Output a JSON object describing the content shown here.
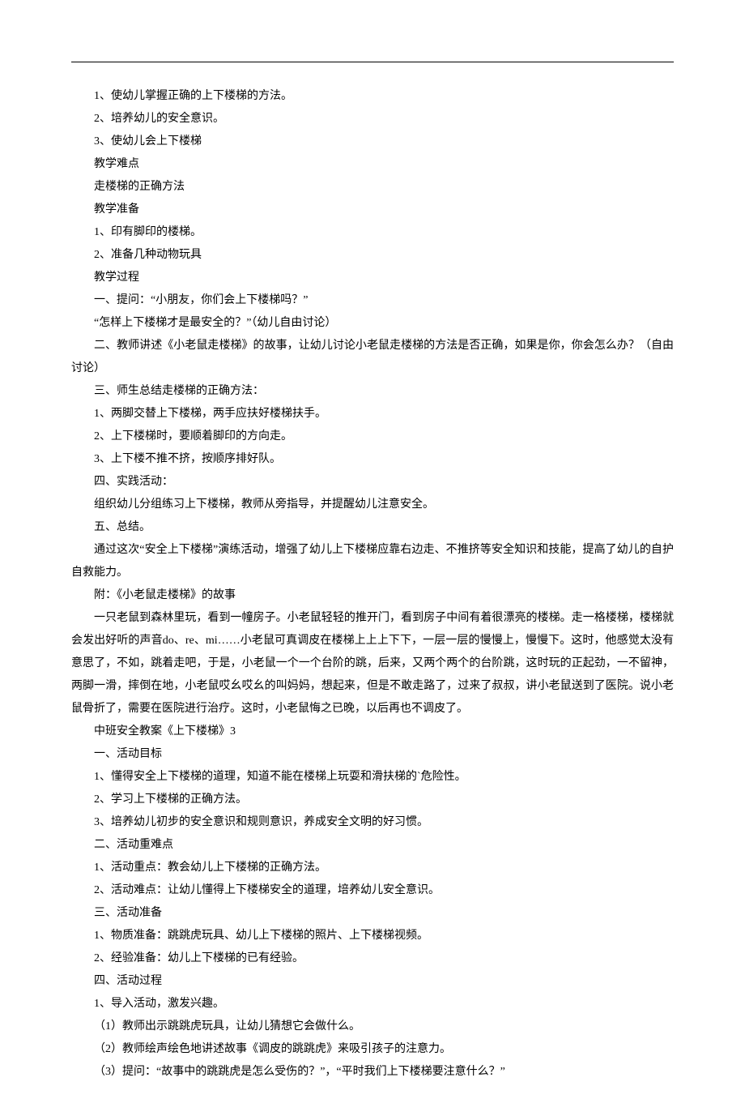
{
  "paragraphs": [
    "1、使幼儿掌握正确的上下楼梯的方法。",
    "2、培养幼儿的安全意识。",
    "3、使幼儿会上下楼梯",
    "教学难点",
    "走楼梯的正确方法",
    "教学准备",
    "1、印有脚印的楼梯。",
    "2、准备几种动物玩具",
    "教学过程",
    "一、提问：“小朋友，你们会上下楼梯吗？”",
    "“怎样上下楼梯才是最安全的？”（幼儿自由讨论）",
    "二、教师讲述《小老鼠走楼梯》的故事，让幼儿讨论小老鼠走楼梯的方法是否正确，如果是你，你会怎么办？（自由讨论）",
    "三、师生总结走楼梯的正确方法：",
    "1、两脚交替上下楼梯，两手应扶好楼梯扶手。",
    "2、上下楼梯时，要顺着脚印的方向走。",
    "3、上下楼不推不挤，按顺序排好队。",
    "四、实践活动：",
    "组织幼儿分组练习上下楼梯，教师从旁指导，并提醒幼儿注意安全。",
    "五、总结。",
    "通过这次“安全上下楼梯”演练活动，增强了幼儿上下楼梯应靠右边走、不推挤等安全知识和技能，提高了幼儿的自护自救能力。",
    "附：《小老鼠走楼梯》的故事",
    "一只老鼠到森林里玩，看到一幢房子。小老鼠轻轻的推开门，看到房子中间有着很漂亮的楼梯。走一格楼梯，楼梯就会发出好听的声音do、re、mi……小老鼠可真调皮在楼梯上上上下下，一层一层的慢慢上，慢慢下。这时，他感觉太没有意思了，不如，跳着走吧，于是，小老鼠一个一个台阶的跳，后来，又两个两个的台阶跳，这时玩的正起劲，一不留神，两脚一滑，摔倒在地，小老鼠哎幺哎幺的叫妈妈，想起来，但是不敢走路了，过来了叔叔，讲小老鼠送到了医院。说小老鼠骨折了，需要在医院进行治疗。这时，小老鼠悔之已晚，以后再也不调皮了。",
    "中班安全教案《上下楼梯》3",
    "一、活动目标",
    "1、懂得安全上下楼梯的道理，知道不能在楼梯上玩耍和滑扶梯的`危险性。",
    "2、学习上下楼梯的正确方法。",
    "3、培养幼儿初步的安全意识和规则意识，养成安全文明的好习惯。",
    "二、活动重难点",
    "1、活动重点：教会幼儿上下楼梯的正确方法。",
    "2、活动难点：让幼儿懂得上下楼梯安全的道理，培养幼儿安全意识。",
    "三、活动准备",
    "1、物质准备：跳跳虎玩具、幼儿上下楼梯的照片、上下楼梯视频。",
    "2、经验准备：幼儿上下楼梯的已有经验。",
    "四、活动过程",
    "1、导入活动，激发兴趣。",
    "（1）教师出示跳跳虎玩具，让幼儿猜想它会做什么。",
    "（2）教师绘声绘色地讲述故事《调皮的跳跳虎》来吸引孩子的注意力。",
    "（3）提问：“故事中的跳跳虎是怎么受伤的？”，“平时我们上下楼梯要注意什么？”"
  ]
}
